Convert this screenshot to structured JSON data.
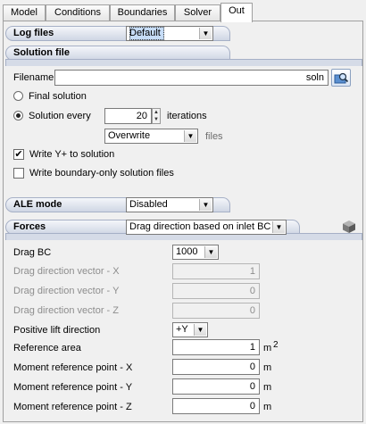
{
  "tabs": [
    "Model",
    "Conditions",
    "Boundaries",
    "Solver",
    "Out"
  ],
  "log_files": {
    "label": "Log files",
    "value": "Default"
  },
  "solution_file": {
    "header": "Solution file",
    "filename_label": "Filename",
    "filename_value": "soln",
    "final_solution_label": "Final solution",
    "solution_every_label": "Solution every",
    "solution_every_value": "20",
    "iterations_label": "iterations",
    "overwrite_value": "Overwrite",
    "files_label": "files",
    "write_yplus_label": "Write Y+ to solution",
    "write_yplus_checked": true,
    "write_boundary_label": "Write boundary-only solution files",
    "write_boundary_checked": false
  },
  "ale_mode": {
    "label": "ALE mode",
    "value": "Disabled"
  },
  "forces": {
    "label": "Forces",
    "value": "Drag direction based on inlet BC",
    "drag_bc_label": "Drag BC",
    "drag_bc_value": "1000",
    "ddv_x_label": "Drag direction vector - X",
    "ddv_x_value": "1",
    "ddv_y_label": "Drag direction vector - Y",
    "ddv_y_value": "0",
    "ddv_z_label": "Drag direction vector - Z",
    "ddv_z_value": "0",
    "lift_label": "Positive lift direction",
    "lift_value": "+Y",
    "ref_area_label": "Reference area",
    "ref_area_value": "1",
    "ref_area_unit": "m",
    "ref_area_exp": "2",
    "mx_label": "Moment reference point - X",
    "mx_value": "0",
    "my_label": "Moment reference point - Y",
    "my_value": "0",
    "mz_label": "Moment reference point - Z",
    "mz_value": "0",
    "length_unit": "m"
  }
}
